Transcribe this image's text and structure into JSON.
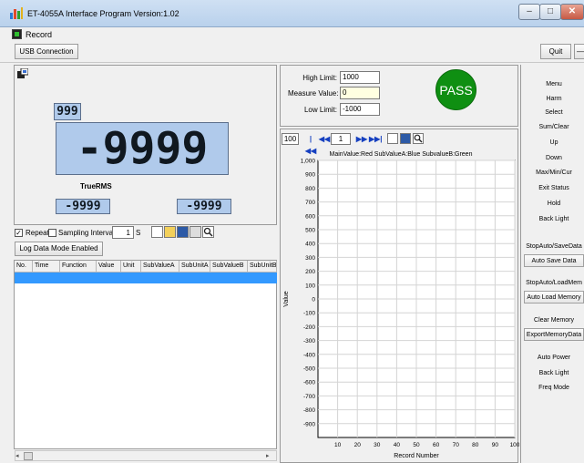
{
  "window": {
    "title": "ET-4055A Interface Program Version:1.02",
    "minimize": "–",
    "maximize": "□",
    "close": "✕"
  },
  "menu": {
    "record": "Record"
  },
  "toolbar": {
    "usb": "USB Connection",
    "quit": "Quit",
    "extra": "—"
  },
  "meter": {
    "small_display": "999",
    "main_display": "-9999",
    "mode_label": "TrueRMS",
    "sub_a": "-9999",
    "sub_b": "-9999"
  },
  "logging": {
    "repeat_checked": "✓",
    "repeat_label": "Repeat",
    "sampling_label": "Sampling Interval",
    "interval_value": "1",
    "interval_unit": "S",
    "log_mode_button": "Log Data Mode Enabled"
  },
  "table": {
    "columns": [
      "No.",
      "Time",
      "Function",
      "Value",
      "Unit",
      "SubValueA",
      "SubUnitA",
      "SubValueB",
      "SubUnitB"
    ]
  },
  "limits": {
    "high_label": "High Limit:",
    "high_value": "1000",
    "measure_label": "Measure Value:",
    "measure_value": "0",
    "low_label": "Low Limit:",
    "low_value": "-1000",
    "result": "PASS"
  },
  "chart_controls": {
    "page_size": "100",
    "page_number": "1",
    "first": "|◀◀",
    "prev": "◀◀",
    "next": "▶▶",
    "last": "▶▶|"
  },
  "chart_data": {
    "type": "line",
    "title": "MainValue:Red SubValueA:Blue SubvalueB:Green",
    "xlabel": "Record Number",
    "ylabel": "Value",
    "x_ticks": [
      "10",
      "20",
      "30",
      "40",
      "50",
      "60",
      "70",
      "80",
      "90",
      "100"
    ],
    "y_ticks": [
      "1,000",
      "900",
      "800",
      "700",
      "600",
      "500",
      "400",
      "300",
      "200",
      "100",
      "0",
      "-100",
      "-200",
      "-300",
      "-400",
      "-500",
      "-600",
      "-700",
      "-800",
      "-900"
    ],
    "xlim": [
      0,
      100
    ],
    "ylim": [
      -1000,
      1000
    ],
    "grid": true,
    "series": [],
    "colors": {
      "main": "#ff0000",
      "sub_a": "#0000ff",
      "sub_b": "#008000"
    }
  },
  "commands": [
    {
      "label": "Menu"
    },
    {
      "label": "Harm"
    },
    {
      "label": "Select"
    },
    {
      "label": "Sum/Clear"
    },
    {
      "label": "Up"
    },
    {
      "label": "Down"
    },
    {
      "label": "Max/Min/Cur"
    },
    {
      "label": "Exit Status"
    },
    {
      "label": "Hold"
    },
    {
      "label": "Back Light"
    },
    {
      "label": "StopAuto/SaveData"
    },
    {
      "label": "Auto Save Data"
    },
    {
      "label": "StopAuto/LoadMem"
    },
    {
      "label": "Auto Load Memory"
    },
    {
      "label": "Clear Memory"
    },
    {
      "label": "ExportMemoryData"
    },
    {
      "label": "Auto Power"
    },
    {
      "label": "Back Light"
    },
    {
      "label": "Freq Mode"
    }
  ],
  "colors": {
    "lcd_bg": "#b0caeb",
    "pass_green": "#0f8f12",
    "selection_blue": "#3399ff"
  }
}
